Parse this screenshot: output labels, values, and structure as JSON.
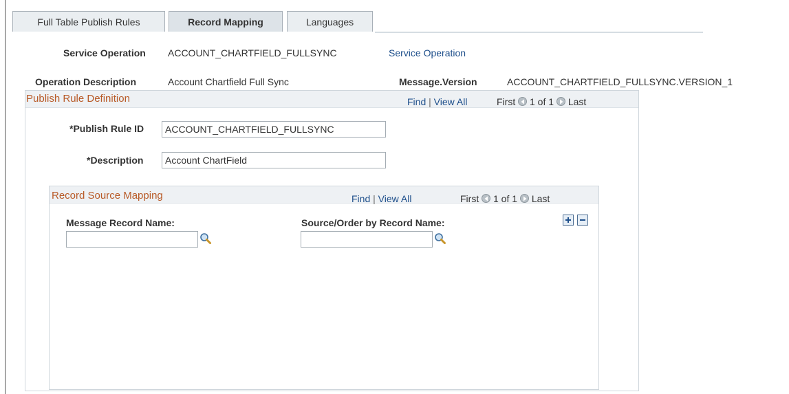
{
  "tabs": [
    {
      "label": "Full Table Publish Rules",
      "active": false
    },
    {
      "label": "Record Mapping",
      "active": true
    },
    {
      "label": "Languages",
      "active": false
    }
  ],
  "header": {
    "service_operation_label": "Service Operation",
    "service_operation_value": "ACCOUNT_CHARTFIELD_FULLSYNC",
    "service_operation_link": "Service Operation",
    "operation_description_label": "Operation Description",
    "operation_description_value": "Account Chartfield Full Sync",
    "message_version_label": "Message.Version",
    "message_version_value": "ACCOUNT_CHARTFIELD_FULLSYNC.VERSION_1"
  },
  "publish_rule": {
    "title": "Publish Rule Definition",
    "nav": {
      "find": "Find",
      "sep": "|",
      "view_all": "View All",
      "first": "First",
      "count": "1 of 1",
      "last": "Last"
    },
    "rule_id_label": "*Publish Rule ID",
    "rule_id_value": "ACCOUNT_CHARTFIELD_FULLSYNC",
    "description_label": "*Description",
    "description_value": "Account ChartField"
  },
  "record_source": {
    "title": "Record Source Mapping",
    "nav": {
      "find": "Find",
      "sep": "|",
      "view_all": "View All",
      "first": "First",
      "count": "1 of 1",
      "last": "Last"
    },
    "message_record_label": "Message Record Name:",
    "message_record_value": "",
    "source_record_label": "Source/Order by Record Name:",
    "source_record_value": ""
  },
  "icons": {
    "lookup": "magnifier-icon",
    "prev": "prev-arrow-icon",
    "next": "next-arrow-icon",
    "add_row": "plus-icon",
    "delete_row": "minus-icon"
  },
  "colors": {
    "group_title": "#b85a27",
    "link": "#1e4f8b",
    "header_band": "#eef1f4"
  }
}
